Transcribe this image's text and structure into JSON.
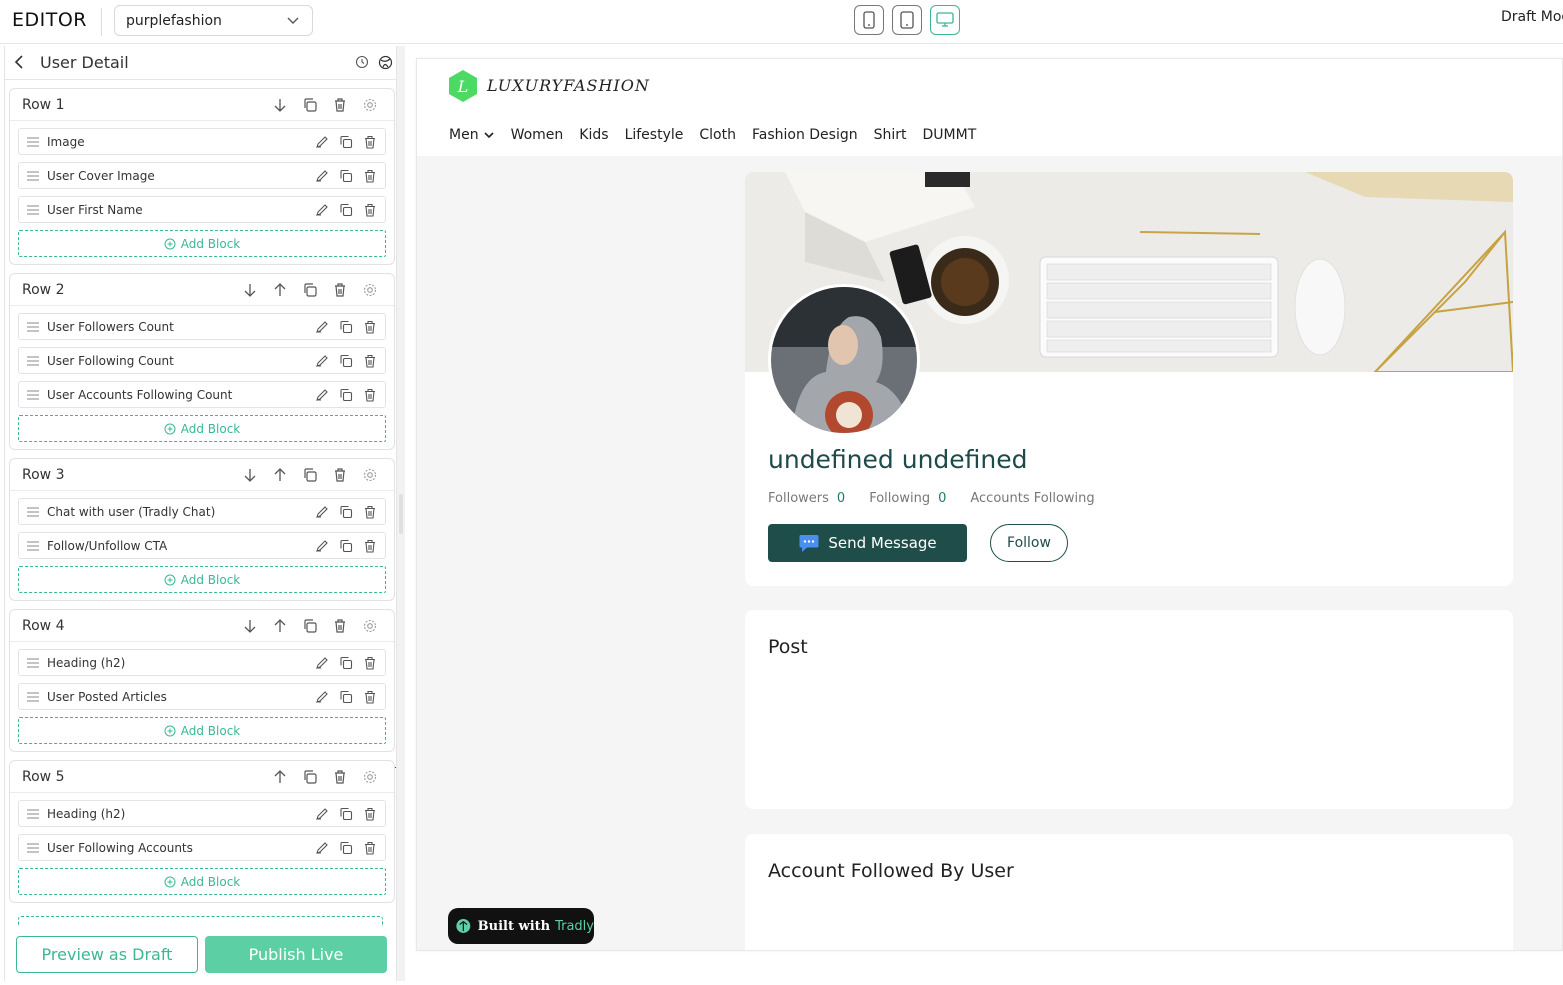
{
  "topbar": {
    "editor_label": "EDITOR",
    "site_select": "purplefashion",
    "mode_label": "Draft Mode"
  },
  "panel": {
    "title": "User Detail",
    "add_block_label": "Add Block",
    "rows": [
      {
        "name": "Row 1",
        "blocks": [
          "Image",
          "User Cover Image",
          "User First Name"
        ]
      },
      {
        "name": "Row 2",
        "blocks": [
          "User Followers Count",
          "User Following Count",
          "User Accounts Following Count"
        ]
      },
      {
        "name": "Row 3",
        "blocks": [
          "Chat with user (Tradly Chat)",
          "Follow/Unfollow CTA"
        ]
      },
      {
        "name": "Row 4",
        "blocks": [
          "Heading (h2)",
          "User Posted Articles"
        ]
      },
      {
        "name": "Row 5",
        "blocks": [
          "Heading (h2)",
          "User Following Accounts"
        ]
      }
    ],
    "preview_label": "Preview as Draft",
    "publish_label": "Publish Live"
  },
  "site": {
    "logo_text": "LUXURYFASHION",
    "nav": [
      "Men",
      "Women",
      "Kids",
      "Lifestyle",
      "Cloth",
      "Fashion Design",
      "Shirt",
      "DUMMT"
    ],
    "profile": {
      "name": "undefined undefined",
      "followers_label": "Followers",
      "followers_value": "0",
      "following_label": "Following",
      "following_value": "0",
      "accounts_following_label": "Accounts Following",
      "send_message_label": "Send Message",
      "follow_label": "Follow"
    },
    "post_heading": "Post",
    "followed_heading": "Account Followed By User",
    "badge_prefix": "Built with",
    "badge_brand": "Tradly"
  },
  "colors": {
    "accent": "#3ab795",
    "publish": "#5ccfa4",
    "brand_dark": "#1f4d4a"
  }
}
